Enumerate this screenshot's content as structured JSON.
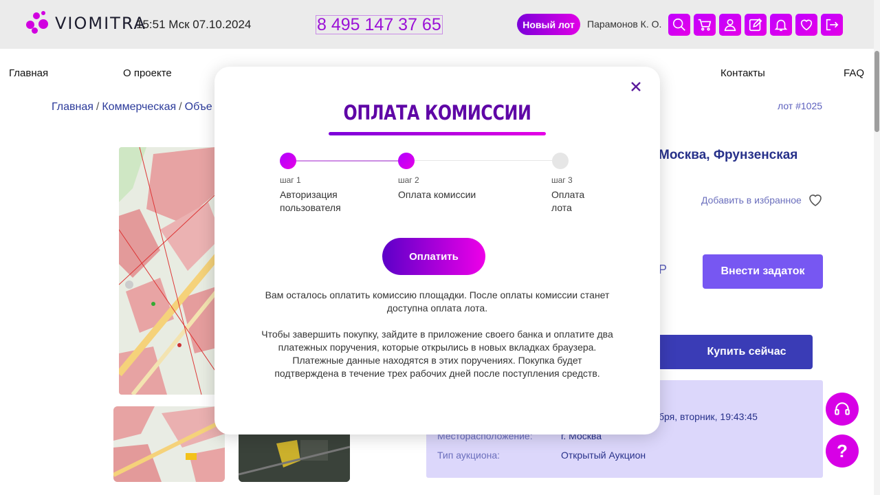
{
  "header": {
    "logo_text": "VIOMITRA",
    "datetime": "15:51 Мск 07.10.2024",
    "phone": "8 495 147 37 65",
    "new_lot_label": "Новый лот",
    "user_name": "Парамонов К. О.",
    "icons": [
      "search-icon",
      "cart-icon",
      "user-icon",
      "edit-icon",
      "bell-icon",
      "heart-icon",
      "logout-icon"
    ]
  },
  "nav": {
    "home": "Главная",
    "about": "О проекте",
    "contacts": "Контакты",
    "faq": "FAQ"
  },
  "breadcrumb": {
    "items": [
      "Главная",
      "Коммерческая",
      "Объе"
    ],
    "separator": "/"
  },
  "lot": {
    "number": "лот #1025",
    "title_fragment": "Москва, Фрунзенская",
    "add_favorite": "Добавить в избранное",
    "price_fragment": "Р",
    "deposit_button": "Внести задаток",
    "buy_now_button": "Купить сейчас",
    "date_fragment": "бря, вторник, 19:43:45",
    "location_label": "Месторасположение:",
    "location_value": "г. Москва",
    "auction_type_label": "Тип аукциона:",
    "auction_type_value": "Открытый Аукцион"
  },
  "modal": {
    "title": "ОПЛАТА КОМИССИИ",
    "steps": [
      {
        "num": "шаг 1",
        "label": "Авторизация пользователя",
        "state": "done"
      },
      {
        "num": "шаг 2",
        "label": "Оплата комиссии",
        "state": "active"
      },
      {
        "num": "шаг 3",
        "label": "Оплата лота",
        "state": "pending"
      }
    ],
    "pay_button": "Оплатить",
    "text1": "Вам осталось оплатить комиссию площадки. После оплаты комиссии станет доступна оплата лота.",
    "text2": "Чтобы завершить покупку, зайдите в приложение своего банка и оплатите два платежных поручения, которые открылись в новых вкладках браузера. Платежные данные находятся в этих поручениях. Покупка будет подтверждена в течение трех рабочих дней после поступления средств."
  },
  "floating": {
    "support_icon": "headset-icon",
    "help_label": "?"
  },
  "colors": {
    "accent": "#d100e0",
    "accent_purple": "#5f06a6",
    "deposit": "#7757f2",
    "buy": "#3a3cb6",
    "info_bg": "#dcd7fb"
  }
}
